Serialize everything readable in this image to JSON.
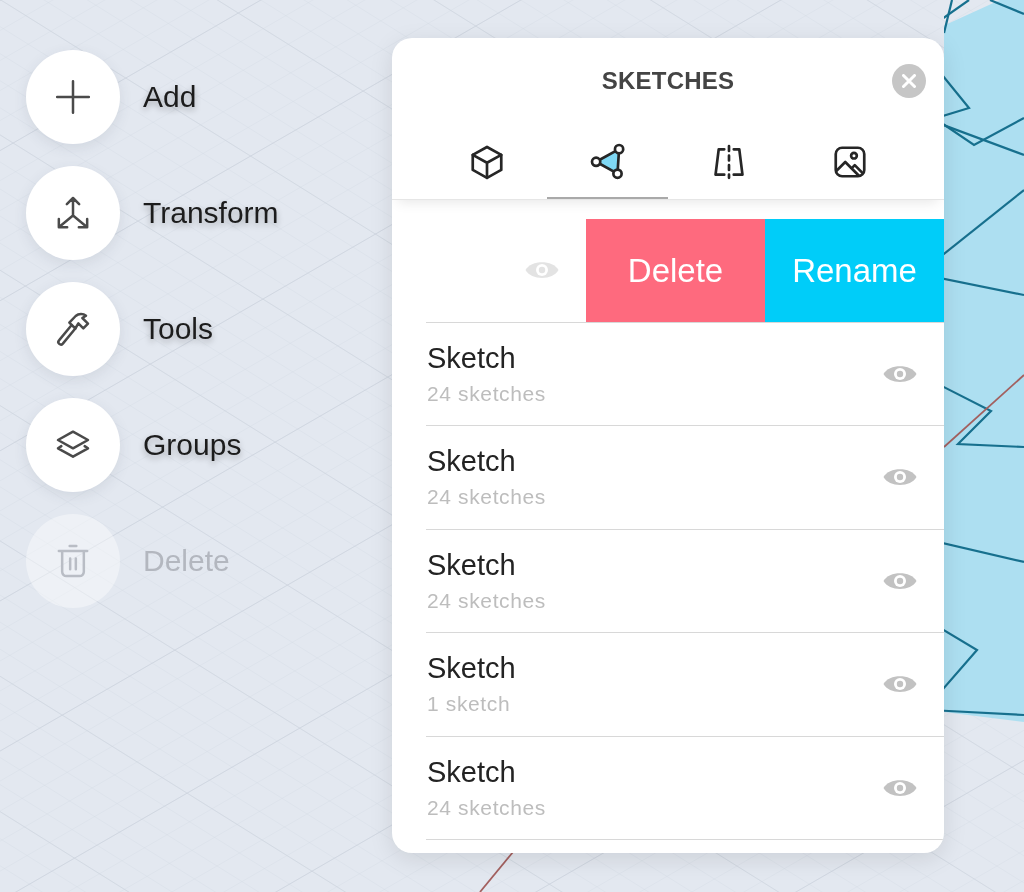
{
  "tool_menu": [
    {
      "kind": "add",
      "label": "Add",
      "disabled": false
    },
    {
      "kind": "transform",
      "label": "Transform",
      "disabled": false
    },
    {
      "kind": "tools",
      "label": "Tools",
      "disabled": false
    },
    {
      "kind": "groups",
      "label": "Groups",
      "disabled": false
    },
    {
      "kind": "delete",
      "label": "Delete",
      "disabled": true
    }
  ],
  "panel": {
    "title": "SKETCHES",
    "tabs": [
      {
        "kind": "cube",
        "selected": false
      },
      {
        "kind": "sketch",
        "selected": true
      },
      {
        "kind": "mirror",
        "selected": false
      },
      {
        "kind": "image",
        "selected": false
      }
    ],
    "rows": [
      {
        "swiped": true,
        "actions": [
          {
            "kind": "delete",
            "label": "Delete"
          },
          {
            "kind": "rename",
            "label": "Rename"
          }
        ]
      },
      {
        "swiped": false,
        "title": "Sketch",
        "subtitle": "24 sketches"
      },
      {
        "swiped": false,
        "title": "Sketch",
        "subtitle": "24 sketches"
      },
      {
        "swiped": false,
        "title": "Sketch",
        "subtitle": "24 sketches"
      },
      {
        "swiped": false,
        "title": "Sketch",
        "subtitle": "1 sketch"
      },
      {
        "swiped": false,
        "title": "Sketch",
        "subtitle": "24 sketches"
      }
    ]
  }
}
